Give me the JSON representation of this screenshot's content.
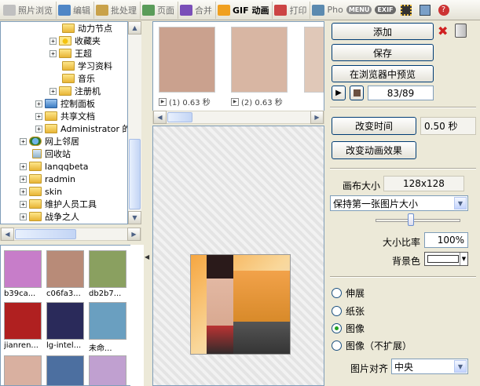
{
  "toolbar": {
    "tabs": [
      {
        "label": "照片浏览",
        "icon": "photo-browse-icon",
        "color": "#c0c0c0"
      },
      {
        "label": "编辑",
        "icon": "edit-icon",
        "color": "#4f86c6"
      },
      {
        "label": "批处理",
        "icon": "batch-icon",
        "color": "#c9a24a"
      },
      {
        "label": "页面",
        "icon": "page-icon",
        "color": "#5a9c5a"
      },
      {
        "label": "合并",
        "icon": "merge-icon",
        "color": "#7a4fb8"
      },
      {
        "label": "GIF 动画",
        "icon": "gif-animation-icon",
        "color": "#f0a020"
      },
      {
        "label": "打印",
        "icon": "print-icon",
        "color": "#cc4444"
      },
      {
        "label": "Pho",
        "icon": "photo-icon",
        "color": "#5b8ab0"
      }
    ],
    "menu_label": "MENU",
    "exif_label": "EXIF"
  },
  "tree": {
    "items": [
      {
        "label": "动力节点",
        "type": "folder"
      },
      {
        "label": "收藏夹",
        "type": "favorites"
      },
      {
        "label": "王超",
        "type": "folder"
      },
      {
        "label": "学习资料",
        "type": "folder"
      },
      {
        "label": "音乐",
        "type": "folder"
      },
      {
        "label": "注册机",
        "type": "folder"
      },
      {
        "label": "控制面板",
        "type": "control-panel"
      },
      {
        "label": "共享文档",
        "type": "folder"
      },
      {
        "label": "Administrator 的",
        "type": "folder"
      },
      {
        "label": "网上邻居",
        "type": "network"
      },
      {
        "label": "回收站",
        "type": "recycle-bin"
      },
      {
        "label": "lanqqbeta",
        "type": "folder"
      },
      {
        "label": "radmin",
        "type": "folder"
      },
      {
        "label": "skin",
        "type": "folder"
      },
      {
        "label": "维护人员工具",
        "type": "folder"
      },
      {
        "label": "战争之人",
        "type": "folder"
      }
    ]
  },
  "thumbnails": [
    {
      "caption": "b39ca...",
      "color": "#c77dc9"
    },
    {
      "caption": "c06fa3...",
      "color": "#b88b78"
    },
    {
      "caption": "db2b7...",
      "color": "#8aa060"
    },
    {
      "caption": "jianren...",
      "color": "#b02020"
    },
    {
      "caption": "lg-intel...",
      "color": "#2a2a5a"
    },
    {
      "caption": "未命...",
      "color": "#6a9fc0"
    },
    {
      "caption": "",
      "color": "#d9b0a0"
    },
    {
      "caption": "",
      "color": "#4c6fa0"
    },
    {
      "caption": "",
      "color": "#c0a0d0"
    }
  ],
  "frames": [
    {
      "caption": "(1) 0.63 秒",
      "color": "#caa18e"
    },
    {
      "caption": "(2) 0.63 秒",
      "color": "#d8b6a3"
    }
  ],
  "controls": {
    "add_label": "添加",
    "save_label": "保存",
    "preview_label": "在浏览器中预览",
    "frame_counter": "83/89",
    "change_time_label": "改变时间",
    "time_value": "0.50 秒",
    "change_effect_label": "改变动画效果",
    "canvas_size_label": "画布大小",
    "canvas_size_value": "128x128",
    "keep_size_option": "保持第一张图片大小",
    "scale_label": "大小比率",
    "scale_value": "100%",
    "bg_color_label": "背景色",
    "bg_color": "#ffffff",
    "radio_options": [
      {
        "label": "伸展",
        "selected": false
      },
      {
        "label": "纸张",
        "selected": false
      },
      {
        "label": "图像",
        "selected": true
      },
      {
        "label": "图像（不扩展）",
        "selected": false
      }
    ],
    "align_label": "图片对齐",
    "align_value": "中央"
  }
}
